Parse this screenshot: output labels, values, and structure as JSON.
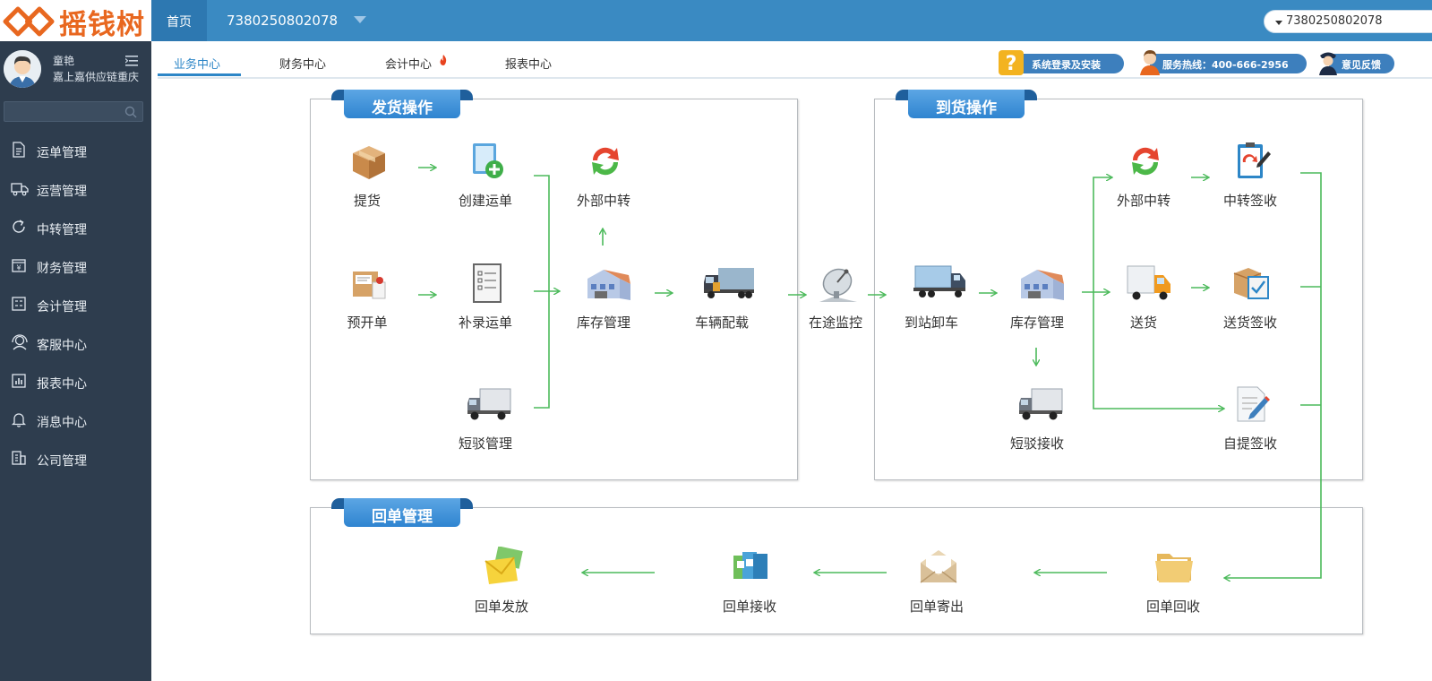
{
  "app": {
    "logo_text": "摇钱树"
  },
  "user": {
    "name": "童艳",
    "company": "嘉上嘉供应链重庆"
  },
  "sidebar": {
    "search_placeholder": "",
    "items": [
      {
        "label": "运单管理",
        "icon": "document-icon"
      },
      {
        "label": "运营管理",
        "icon": "truck-icon"
      },
      {
        "label": "中转管理",
        "icon": "refresh-icon"
      },
      {
        "label": "财务管理",
        "icon": "finance-icon"
      },
      {
        "label": "会计管理",
        "icon": "ledger-icon"
      },
      {
        "label": "客服中心",
        "icon": "headset-icon"
      },
      {
        "label": "报表中心",
        "icon": "bar-chart-icon"
      },
      {
        "label": "消息中心",
        "icon": "bell-icon"
      },
      {
        "label": "公司管理",
        "icon": "building-icon"
      }
    ]
  },
  "topbar": {
    "home_tab": "首页",
    "waybill_tab": "7380250802078",
    "search_value": "7380250802078"
  },
  "subnav": {
    "tabs": [
      "业务中心",
      "财务中心",
      "会计中心",
      "报表中心"
    ],
    "active_tab": "业务中心",
    "system_login": "系统登录及安装",
    "hotline": "服务热线：400-666-2956",
    "feedback": "意见反馈"
  },
  "panels": {
    "shipping": {
      "title": "发货操作",
      "nodes": {
        "pickup": "提货",
        "create_waybill": "创建运单",
        "external_transfer": "外部中转",
        "pre_order": "预开单",
        "supplement_waybill": "补录运单",
        "inventory": "库存管理",
        "vehicle_loading": "车辆配载",
        "short_haul": "短驳管理"
      }
    },
    "monitor": "在途监控",
    "arrival": {
      "title": "到货操作",
      "nodes": {
        "external_transfer": "外部中转",
        "transfer_sign": "中转签收",
        "unload": "到站卸车",
        "inventory": "库存管理",
        "delivery": "送货",
        "delivery_sign": "送货签收",
        "short_haul_receive": "短驳接收",
        "self_pickup_sign": "自提签收"
      }
    },
    "receipt": {
      "title": "回单管理",
      "nodes": {
        "issue": "回单发放",
        "receive": "回单接收",
        "send": "回单寄出",
        "recover": "回单回收"
      }
    }
  },
  "colors": {
    "sidebar_bg": "#2e3d4e",
    "topbar_bg": "#3a8ac2",
    "accent": "#2d86c7",
    "flow_arrow": "#4cba5b",
    "brand_orange": "#e8671f"
  }
}
